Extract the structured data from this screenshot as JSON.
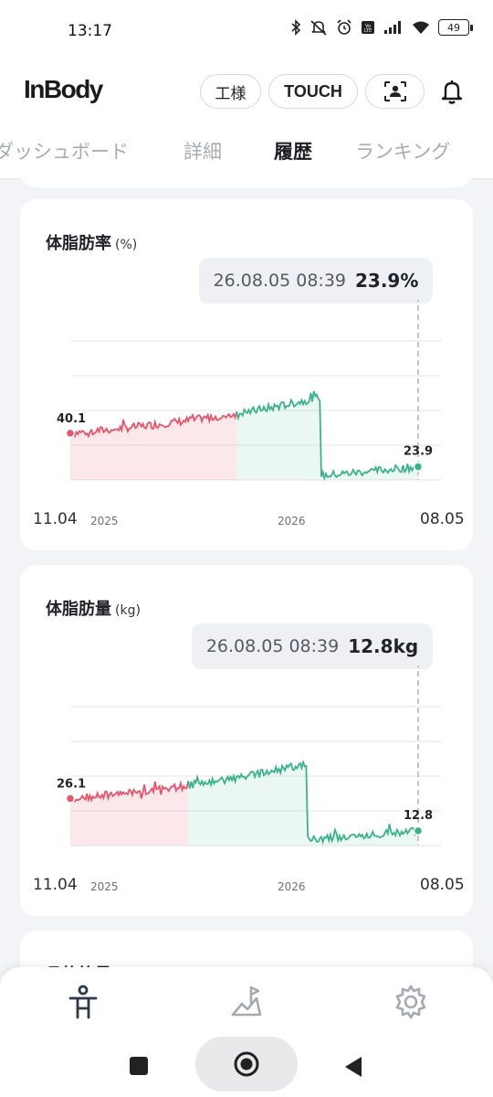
{
  "status": {
    "time": "13:17",
    "battery": "49"
  },
  "header": {
    "logo": "InBody",
    "user_label": "工様",
    "touch_label": "TOUCH"
  },
  "tabs": [
    {
      "label": "ダッシュボード",
      "active": false
    },
    {
      "label": "詳細",
      "active": false
    },
    {
      "label": "履歴",
      "active": true
    },
    {
      "label": "ランキング",
      "active": false
    }
  ],
  "cards": [
    {
      "title": "体脂肪率",
      "unit": "(%)",
      "tooltip_date": "26.08.05 08:39",
      "tooltip_value": "23.9%",
      "start_date": "11.04",
      "end_date": "08.05",
      "year_labels": [
        "2025",
        "2026"
      ],
      "start_value": "40.1",
      "end_value": "23.9"
    },
    {
      "title": "体脂肪量",
      "unit": "(kg)",
      "tooltip_date": "26.08.05 08:39",
      "tooltip_value": "12.8kg",
      "start_date": "11.04",
      "end_date": "08.05",
      "year_labels": [
        "2025",
        "2026"
      ],
      "start_value": "26.1",
      "end_value": "12.8"
    },
    {
      "title": "骨格筋量"
    }
  ],
  "chart_data": [
    {
      "type": "line",
      "x_start": "11.04",
      "x_end": "08.05",
      "x_year_labels": [
        "2025",
        "2026"
      ],
      "y_start": 40.1,
      "y_end": 23.9,
      "ylim": [
        22,
        42
      ],
      "colors": {
        "above_target": "#e9546b",
        "below_target": "#3bb38a"
      },
      "grid": true
    },
    {
      "type": "line",
      "x_start": "11.04",
      "x_end": "08.05",
      "x_year_labels": [
        "2025",
        "2026"
      ],
      "y_start": 26.1,
      "y_end": 12.8,
      "ylim": [
        11,
        28
      ],
      "colors": {
        "above_target": "#e9546b",
        "below_target": "#3bb38a"
      },
      "grid": true
    }
  ]
}
